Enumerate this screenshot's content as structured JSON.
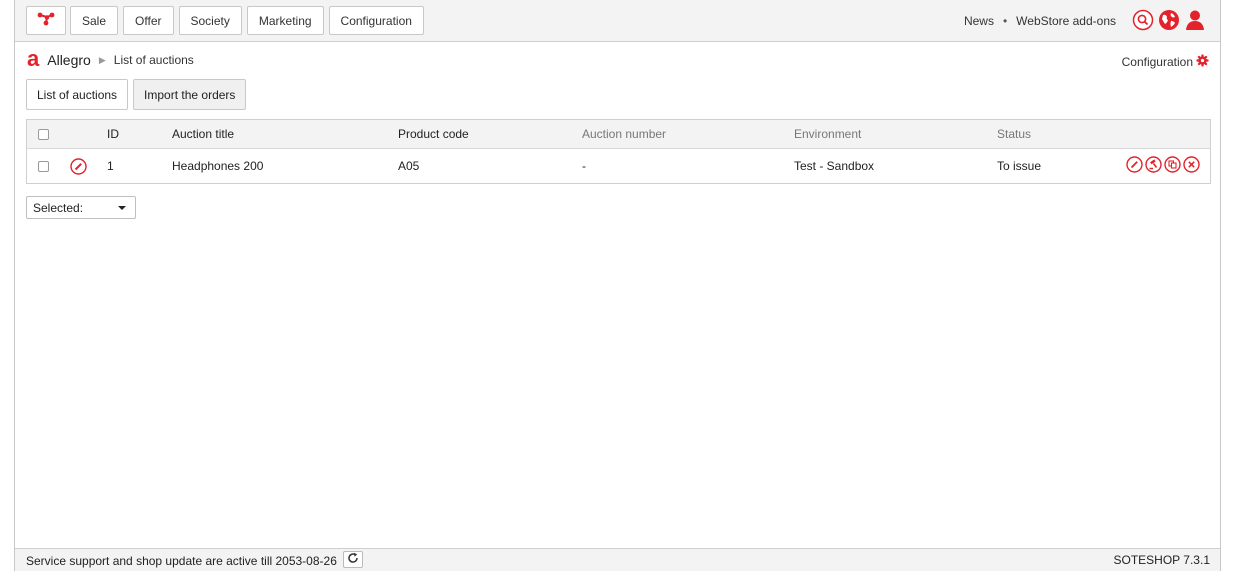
{
  "colors": {
    "accent": "#e3222b",
    "topbar_bg": "#f3f3f3",
    "border": "#c8c8c8"
  },
  "topbar": {
    "logo_icon": "network-logo-icon",
    "nav": [
      {
        "label": "Sale"
      },
      {
        "label": "Offer"
      },
      {
        "label": "Society"
      },
      {
        "label": "Marketing"
      },
      {
        "label": "Configuration"
      }
    ],
    "links": {
      "news": "News",
      "separator": "•",
      "addons": "WebStore add-ons"
    },
    "icons": [
      "search-icon",
      "globe-icon",
      "user-icon"
    ]
  },
  "breadcrumb": {
    "app_icon": "allegro-icon",
    "app_letter": "a",
    "app_name": "Allegro",
    "separator": "▶",
    "current": "List of auctions"
  },
  "config_link": {
    "label": "Configuration",
    "icon": "gear-icon"
  },
  "tabs": [
    {
      "label": "List of auctions",
      "active": true
    },
    {
      "label": "Import the orders",
      "active": false
    }
  ],
  "table": {
    "headers": {
      "id": "ID",
      "title": "Auction title",
      "product_code": "Product code",
      "auction_number": "Auction number",
      "environment": "Environment",
      "status": "Status"
    },
    "rows": [
      {
        "id": "1",
        "title": "Headphones 200",
        "product_code": "A05",
        "auction_number": "-",
        "environment": "Test - Sandbox",
        "status": "To issue",
        "actions": [
          "edit-icon",
          "auction-icon",
          "copy-icon",
          "delete-icon"
        ]
      }
    ]
  },
  "bulk_select": {
    "value": "Selected:"
  },
  "footer": {
    "support_text": "Service support and shop update are active till 2053-08-26",
    "refresh_icon": "refresh-icon",
    "version": "SOTESHOP 7.3.1"
  }
}
